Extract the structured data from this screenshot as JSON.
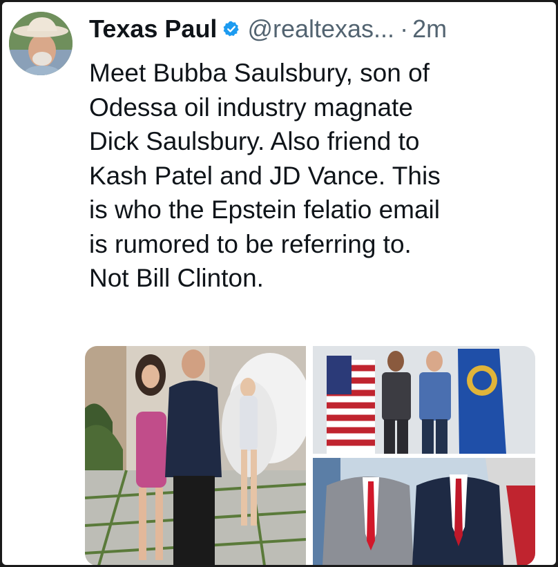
{
  "tweet": {
    "author_name": "Texas Paul",
    "handle": "@realtexas...",
    "separator": "·",
    "time": "2m",
    "body_lines": [
      "Meet Bubba Saulsbury, son of",
      "Odessa oil industry magnate",
      "Dick Saulsbury.  Also friend to",
      "Kash Patel and JD Vance.  This",
      "is who the Epstein felatio email",
      "is rumored to be referring to.",
      "Not Bill Clinton."
    ]
  },
  "icons": {
    "verified": "verified-badge-icon"
  },
  "colors": {
    "verified_blue": "#1d9bf0",
    "secondary_text": "#536471",
    "primary_text": "#0f1419"
  }
}
